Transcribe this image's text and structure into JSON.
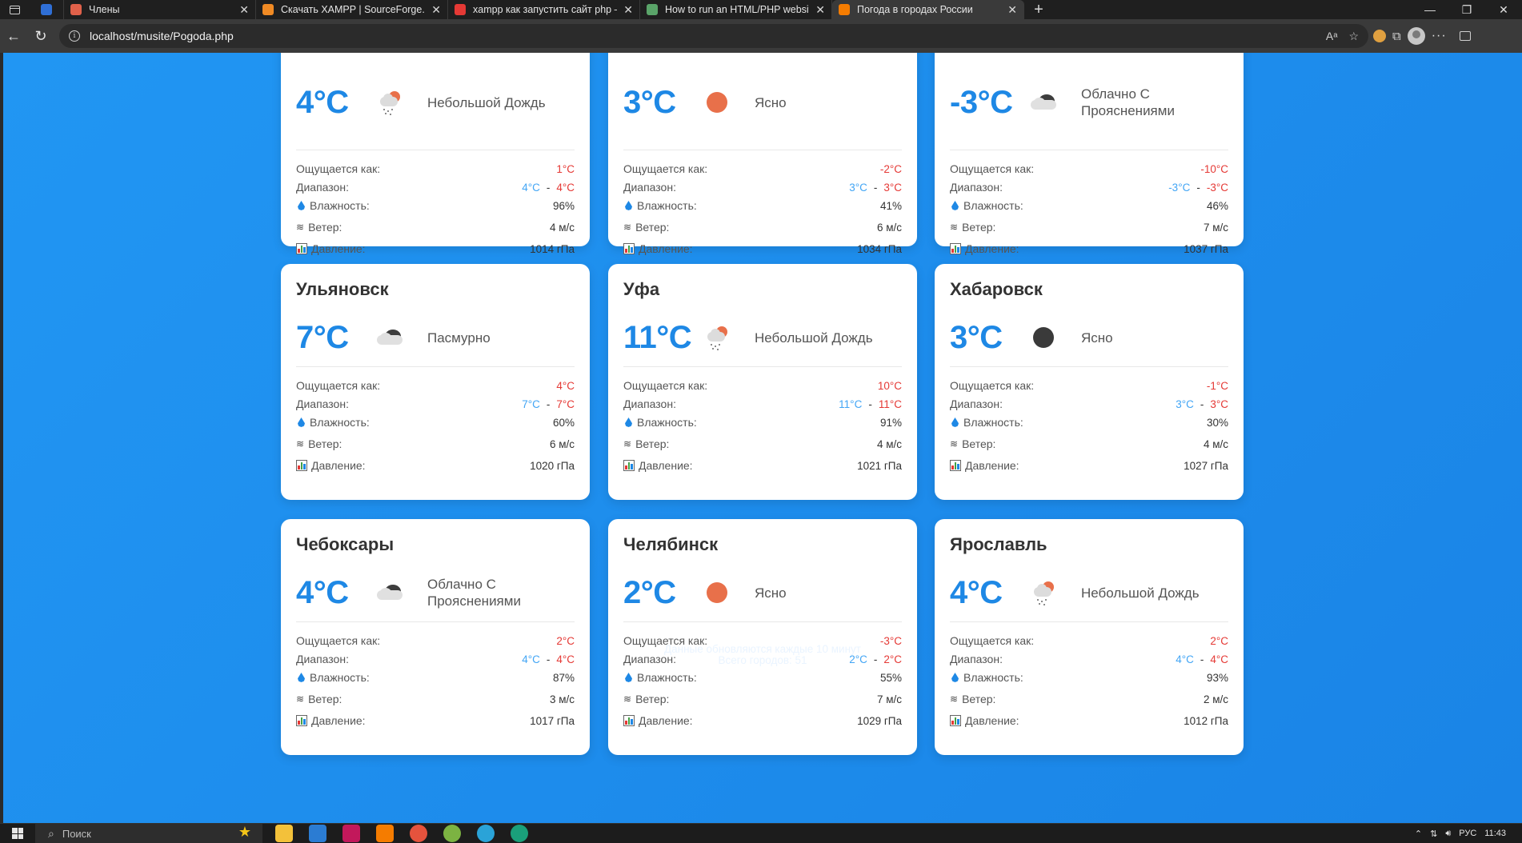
{
  "browser": {
    "tabs": [
      {
        "title": "",
        "favicon_color": "#2f6fd6",
        "pinned": true
      },
      {
        "title": "Члены",
        "favicon_color": "#e0614a"
      },
      {
        "title": "Скачать XAMPP | SourceForge.ne",
        "favicon_color": "#f08a24"
      },
      {
        "title": "xampp как запустить сайт php —",
        "favicon_color": "#e53935"
      },
      {
        "title": "How to run an HTML/PHP website",
        "favicon_color": "#5aa469"
      },
      {
        "title": "Погода в городах России",
        "favicon_color": "#f57c00",
        "active": true
      }
    ],
    "url": "localhost/musite/Pogoda.php"
  },
  "labels": {
    "feels_like": "Ощущается как:",
    "range": "Диапазон:",
    "humidity": "Влажность:",
    "wind": "Ветер:",
    "pressure": "Давление:"
  },
  "cards": [
    {
      "city": "",
      "temp": "4°C",
      "icon": "rain-icon",
      "desc": "Небольшой Дождь",
      "feels": "1°C",
      "min": "4°C",
      "max": "4°C",
      "humidity": "96%",
      "wind": "4 м/с",
      "pressure": "1014 гПа"
    },
    {
      "city": "",
      "temp": "3°C",
      "icon": "sun-icon",
      "desc": "Ясно",
      "feels": "-2°C",
      "min": "3°C",
      "max": "3°C",
      "humidity": "41%",
      "wind": "6 м/с",
      "pressure": "1034 гПа"
    },
    {
      "city": "",
      "temp": "-3°C",
      "icon": "cloud-icon",
      "desc": "Облачно С Прояснениями",
      "feels": "-10°C",
      "min": "-3°C",
      "max": "-3°C",
      "humidity": "46%",
      "wind": "7 м/с",
      "pressure": "1037 гПа"
    },
    {
      "city": "Ульяновск",
      "temp": "7°C",
      "icon": "cloud-icon",
      "desc": "Пасмурно",
      "feels": "4°C",
      "min": "7°C",
      "max": "7°C",
      "humidity": "60%",
      "wind": "6 м/с",
      "pressure": "1020 гПа"
    },
    {
      "city": "Уфа",
      "temp": "11°C",
      "icon": "rain-icon",
      "desc": "Небольшой Дождь",
      "feels": "10°C",
      "min": "11°C",
      "max": "11°C",
      "humidity": "91%",
      "wind": "4 м/с",
      "pressure": "1021 гПа"
    },
    {
      "city": "Хабаровск",
      "temp": "3°C",
      "icon": "moon-icon",
      "desc": "Ясно",
      "feels": "-1°C",
      "min": "3°C",
      "max": "3°C",
      "humidity": "30%",
      "wind": "4 м/с",
      "pressure": "1027 гПа"
    },
    {
      "city": "Чебоксары",
      "temp": "4°C",
      "icon": "cloud-icon",
      "desc": "Облачно С Прояснениями",
      "feels": "2°C",
      "min": "4°C",
      "max": "4°C",
      "humidity": "87%",
      "wind": "3 м/с",
      "pressure": "1017 гПа"
    },
    {
      "city": "Челябинск",
      "temp": "2°C",
      "icon": "sun-icon",
      "desc": "Ясно",
      "feels": "-3°C",
      "min": "2°C",
      "max": "2°C",
      "humidity": "55%",
      "wind": "7 м/с",
      "pressure": "1029 гПа"
    },
    {
      "city": "Ярославль",
      "temp": "4°C",
      "icon": "rain-icon",
      "desc": "Небольшой Дождь",
      "feels": "2°C",
      "min": "4°C",
      "max": "4°C",
      "humidity": "93%",
      "wind": "2 м/с",
      "pressure": "1012 гПа"
    }
  ],
  "footer": {
    "update_note": "Данные обновляются каждые 10 минут",
    "total": "Всего городов: 51"
  },
  "taskbar": {
    "search_placeholder": "Поиск",
    "lang": "РУС",
    "time": "11:43"
  },
  "colors": {
    "page_bg": "#2196f3",
    "temp": "#1e88e5",
    "warm": "#e53935",
    "cool": "#42a5f5"
  }
}
